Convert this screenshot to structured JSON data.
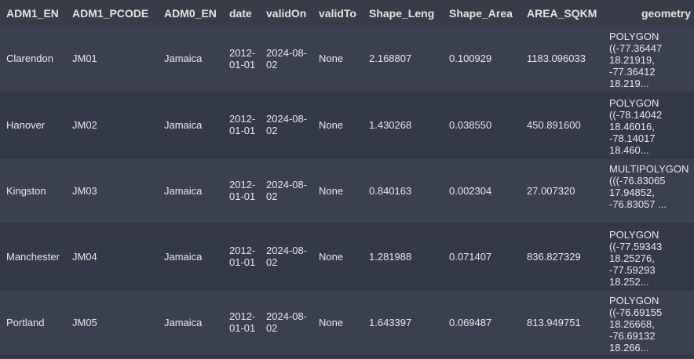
{
  "table": {
    "columns": [
      "ADM1_EN",
      "ADM1_PCODE",
      "ADM0_EN",
      "date",
      "validOn",
      "validTo",
      "Shape_Leng",
      "Shape_Area",
      "AREA_SQKM",
      "geometry"
    ],
    "rows": [
      {
        "adm1_en": "Clarendon",
        "adm1_pcode": "JM01",
        "adm0_en": "Jamaica",
        "date": [
          "2012-",
          "01-01"
        ],
        "valid_on": [
          "2024-08-",
          "02"
        ],
        "valid_to": "None",
        "shape_leng": "2.168807",
        "shape_area": "0.100929",
        "area_sqkm": "1183.096033",
        "geometry": [
          "POLYGON",
          "((-77.36447",
          "18.21919,",
          "-77.36412",
          "18.219..."
        ]
      },
      {
        "adm1_en": "Hanover",
        "adm1_pcode": "JM02",
        "adm0_en": "Jamaica",
        "date": [
          "2012-",
          "01-01"
        ],
        "valid_on": [
          "2024-08-",
          "02"
        ],
        "valid_to": "None",
        "shape_leng": "1.430268",
        "shape_area": "0.038550",
        "area_sqkm": "450.891600",
        "geometry": [
          "POLYGON",
          "((-78.14042",
          "18.46016,",
          "-78.14017",
          "18.460..."
        ]
      },
      {
        "adm1_en": "Kingston",
        "adm1_pcode": "JM03",
        "adm0_en": "Jamaica",
        "date": [
          "2012-",
          "01-01"
        ],
        "valid_on": [
          "2024-08-",
          "02"
        ],
        "valid_to": "None",
        "shape_leng": "0.840163",
        "shape_area": "0.002304",
        "area_sqkm": "27.007320",
        "geometry": [
          "MULTIPOLYGON",
          "(((-76.83065",
          "17.94852,",
          "-76.83057 ..."
        ]
      },
      {
        "adm1_en": "Manchester",
        "adm1_pcode": "JM04",
        "adm0_en": "Jamaica",
        "date": [
          "2012-",
          "01-01"
        ],
        "valid_on": [
          "2024-08-",
          "02"
        ],
        "valid_to": "None",
        "shape_leng": "1.281988",
        "shape_area": "0.071407",
        "area_sqkm": "836.827329",
        "geometry": [
          "POLYGON",
          "((-77.59343",
          "18.25276,",
          "-77.59293",
          "18.252..."
        ]
      },
      {
        "adm1_en": "Portland",
        "adm1_pcode": "JM05",
        "adm0_en": "Jamaica",
        "date": [
          "2012-",
          "01-01"
        ],
        "valid_on": [
          "2024-08-",
          "02"
        ],
        "valid_to": "None",
        "shape_leng": "1.643397",
        "shape_area": "0.069487",
        "area_sqkm": "813.949751",
        "geometry": [
          "POLYGON",
          "((-76.69155",
          "18.26668,",
          "-76.69132",
          "18.266..."
        ]
      }
    ]
  }
}
